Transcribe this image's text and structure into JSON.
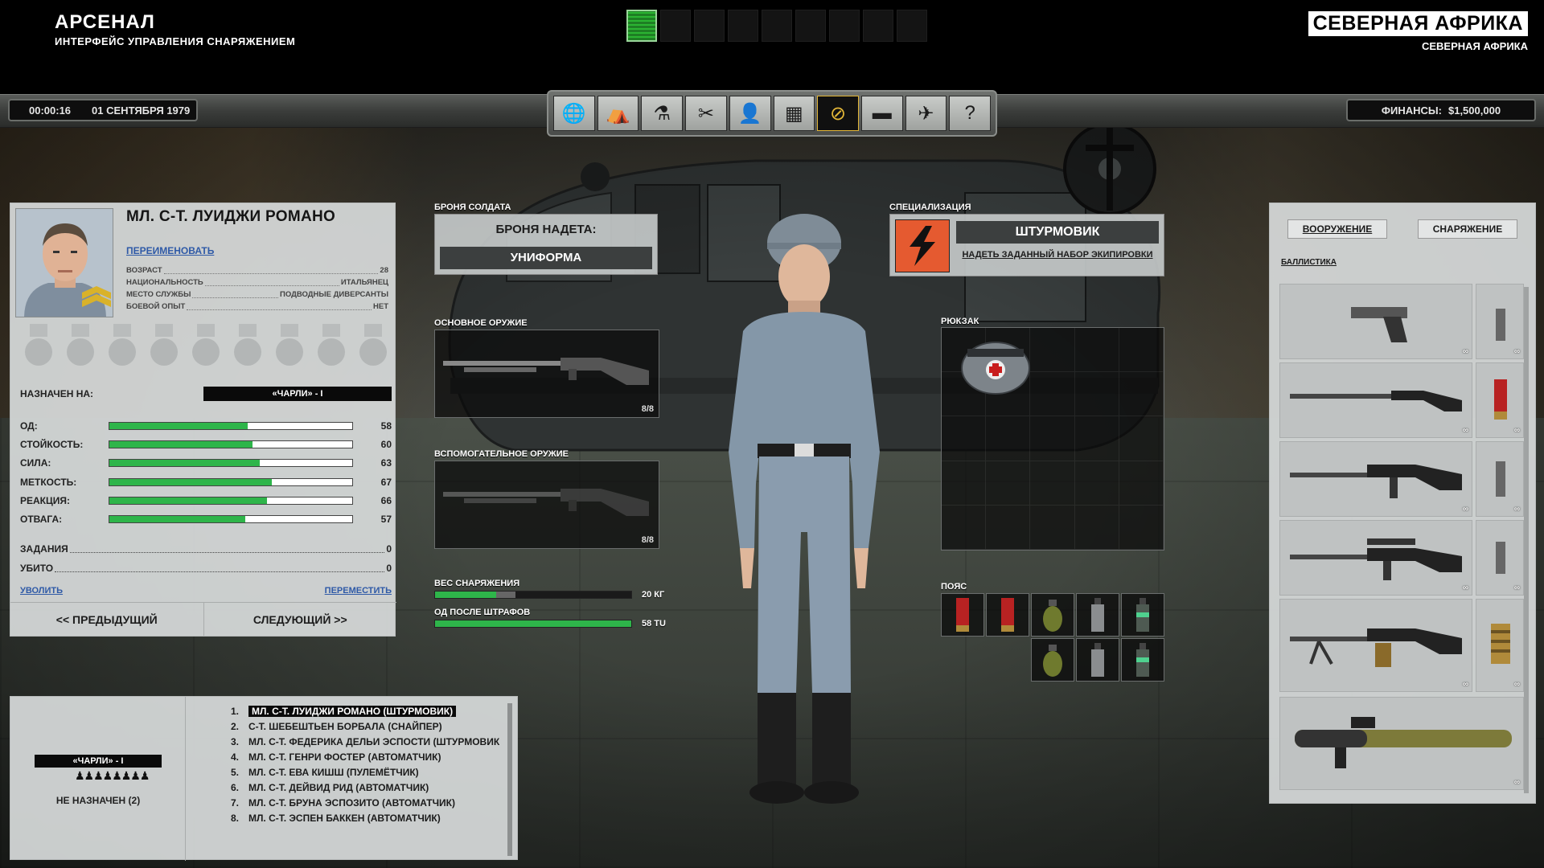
{
  "header": {
    "title": "АРСЕНАЛ",
    "subtitle": "ИНТЕРФЕЙС УПРАВЛЕНИЯ СНАРЯЖЕНИЕМ",
    "region": "СЕВЕРНАЯ АФРИКА",
    "region_sub": "СЕВЕРНАЯ АФРИКА",
    "time": "00:00:16",
    "date": "01 СЕНТЯБРЯ 1979",
    "finance_label": "ФИНАНСЫ:",
    "finance_value": "$1,500,000",
    "progress_squares": 9,
    "progress_active": 1
  },
  "nav": {
    "buttons": [
      {
        "name": "globe-icon",
        "glyph": "🌐"
      },
      {
        "name": "base-icon",
        "glyph": "⛺"
      },
      {
        "name": "research-icon",
        "glyph": "⚗"
      },
      {
        "name": "engineering-icon",
        "glyph": "✂"
      },
      {
        "name": "soldiers-icon",
        "glyph": "👤"
      },
      {
        "name": "stores-icon",
        "glyph": "▦"
      },
      {
        "name": "arsenal-icon",
        "glyph": "⊘"
      },
      {
        "name": "vehicles-icon",
        "glyph": "▬"
      },
      {
        "name": "aircraft-icon",
        "glyph": "✈"
      },
      {
        "name": "help-icon",
        "glyph": "?"
      }
    ],
    "active_index": 6,
    "accent": "#e2b637"
  },
  "soldier": {
    "name": "МЛ. С-Т. ЛУИДЖИ РОМАНО",
    "rename": "ПЕРЕИМЕНОВАТЬ",
    "bio": [
      {
        "k": "ВОЗРАСТ",
        "v": "28"
      },
      {
        "k": "НАЦИОНАЛЬНОСТЬ",
        "v": "ИТАЛЬЯНЕЦ"
      },
      {
        "k": "МЕСТО СЛУЖБЫ",
        "v": "ПОДВОДНЫЕ ДИВЕРСАНТЫ"
      },
      {
        "k": "БОЕВОЙ ОПЫТ",
        "v": "НЕТ"
      }
    ],
    "assigned_label": "НАЗНАЧЕН НА:",
    "assigned_value": "«ЧАРЛИ» - I",
    "stats": [
      {
        "name": "ОД:",
        "value": 58,
        "fill": 0.57
      },
      {
        "name": "СТОЙКОСТЬ:",
        "value": 60,
        "fill": 0.59
      },
      {
        "name": "СИЛА:",
        "value": 63,
        "fill": 0.62
      },
      {
        "name": "МЕТКОСТЬ:",
        "value": 67,
        "fill": 0.67
      },
      {
        "name": "РЕАКЦИЯ:",
        "value": 66,
        "fill": 0.65
      },
      {
        "name": "ОТВАГА:",
        "value": 57,
        "fill": 0.56
      }
    ],
    "missions_label": "ЗАДАНИЯ",
    "missions": "0",
    "kills_label": "УБИТО",
    "kills": "0",
    "dismiss": "УВОЛИТЬ",
    "transfer": "ПЕРЕМЕСТИТЬ",
    "prev": "<< ПРЕДЫДУЩИЙ",
    "next": "СЛЕДУЮЩИЙ >>",
    "stat_color": "#2eb54a"
  },
  "squad": {
    "tag": "«ЧАРЛИ» - I",
    "figures": "♟♟♟♟♟♟♟♟",
    "unassigned": "НЕ НАЗНАЧЕН (2)",
    "roster": [
      {
        "i": "1.",
        "name": "МЛ. С-Т. ЛУИДЖИ РОМАНО (ШТУРМОВИК)"
      },
      {
        "i": "2.",
        "name": "С-Т. ШЕБЕШТЬЕН БОРБАЛА (СНАЙПЕР)"
      },
      {
        "i": "3.",
        "name": "МЛ. С-Т. ФЕДЕРИКА ДЕЛЬИ ЭСПОСТИ (ШТУРМОВИК"
      },
      {
        "i": "4.",
        "name": "МЛ. С-Т. ГЕНРИ ФОСТЕР (АВТОМАТЧИК)"
      },
      {
        "i": "5.",
        "name": "МЛ. С-Т. ЕВА КИШШ (ПУЛЕМЁТЧИК)"
      },
      {
        "i": "6.",
        "name": "МЛ. С-Т. ДЕЙВИД РИД (АВТОМАТЧИК)"
      },
      {
        "i": "7.",
        "name": "МЛ. С-Т. БРУНА ЭСПОЗИТО (АВТОМАТЧИК)"
      },
      {
        "i": "8.",
        "name": "МЛ. С-Т. ЭСПЕН БАККЕН (АВТОМАТЧИК)"
      }
    ],
    "selected_index": 0
  },
  "loadout": {
    "armor_label": "БРОНЯ СОЛДАТА",
    "armor_title": "БРОНЯ НАДЕТА:",
    "armor_value": "УНИФОРМА",
    "primary_label": "ОСНОВНОЕ ОРУЖИЕ",
    "primary_ammo": "8/8",
    "secondary_label": "ВСПОМОГАТЕЛЬНОЕ ОРУЖИЕ",
    "secondary_ammo": "8/8",
    "weight_label": "ВЕС СНАРЯЖЕНИЯ",
    "weight_value": "20 КГ",
    "weight_fill": 0.31,
    "weight_fill2": 0.41,
    "tu_label": "ОД ПОСЛЕ ШТРАФОВ",
    "tu_value": "58 TU",
    "tu_fill": 1.0,
    "spec_label": "СПЕЦИАЛИЗАЦИЯ",
    "spec_name": "ШТУРМОВИК",
    "spec_link": "НАДЕТЬ ЗАДАННЫЙ НАБОР ЭКИПИРОВКИ",
    "spec_color": "#e55a30",
    "backpack_label": "РЮКЗАК",
    "belt_label": "ПОЯС"
  },
  "equipment": {
    "tab_weapons": "ВООРУЖЕНИЕ",
    "tab_gear": "СНАРЯЖЕНИЕ",
    "category": "БАЛЛИСТИКА",
    "items": [
      {
        "name": "pistol",
        "count": "∞",
        "ammo_count": "∞"
      },
      {
        "name": "shotgun",
        "count": "∞",
        "ammo_count": "∞"
      },
      {
        "name": "rifle",
        "count": "∞",
        "ammo_count": "∞"
      },
      {
        "name": "sniper-rifle",
        "count": "∞",
        "ammo_count": "∞"
      },
      {
        "name": "machine-gun",
        "count": "∞",
        "ammo_count": "∞"
      },
      {
        "name": "rocket-launcher",
        "count": "∞"
      }
    ]
  }
}
